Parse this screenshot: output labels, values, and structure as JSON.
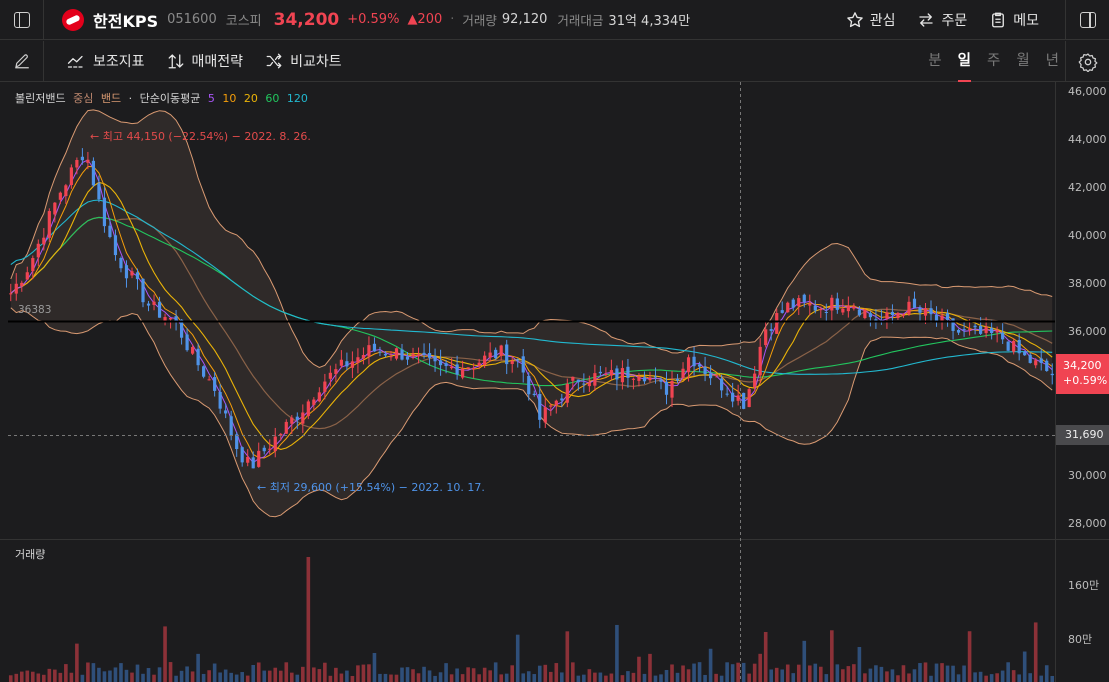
{
  "header": {
    "stock_name": "한전KPS",
    "stock_code": "051600",
    "market": "코스피",
    "price": "34,200",
    "change_rate": "+0.59%",
    "change": "▲200",
    "volume_label": "거래량",
    "volume_value": "92,120",
    "amount_label": "거래대금",
    "amount_value": "31억 4,334만",
    "watch_label": "관심",
    "order_label": "주문",
    "memo_label": "메모"
  },
  "toolbar": {
    "indicator_label": "보조지표",
    "strategy_label": "매매전략",
    "compare_label": "비교차트",
    "periods": [
      "분",
      "일",
      "주",
      "월",
      "년"
    ],
    "selected_period": "일"
  },
  "chart": {
    "legend": {
      "bollinger": "볼린저밴드",
      "center": "중심",
      "band": "밴드",
      "sep": "·",
      "ma": "단순이동평균",
      "ma_periods": [
        "5",
        "10",
        "20",
        "60",
        "120"
      ]
    },
    "annotations": {
      "high": "← 최고 44,150 (−22.54%) − 2022. 8. 26.",
      "low": "← 최저 29,600 (+15.54%) − 2022. 10. 17."
    },
    "level_label": "36383",
    "price_axis": [
      "46,000",
      "44,000",
      "42,000",
      "40,000",
      "38,000",
      "36,000",
      "30,000",
      "28,000"
    ],
    "current_price": "34,200",
    "current_rate": "+0.59%",
    "crosshair_price": "31,690",
    "volume_label": "거래량",
    "volume_axis": [
      "160만",
      "80만"
    ]
  },
  "colors": {
    "up": "#f04452",
    "down": "#4f93e8",
    "ma5": "#a855f7",
    "ma10": "#f59e0b",
    "ma20": "#eab308",
    "ma60": "#22c55e",
    "ma120": "#22b8cf",
    "band": "#d99a72"
  }
}
